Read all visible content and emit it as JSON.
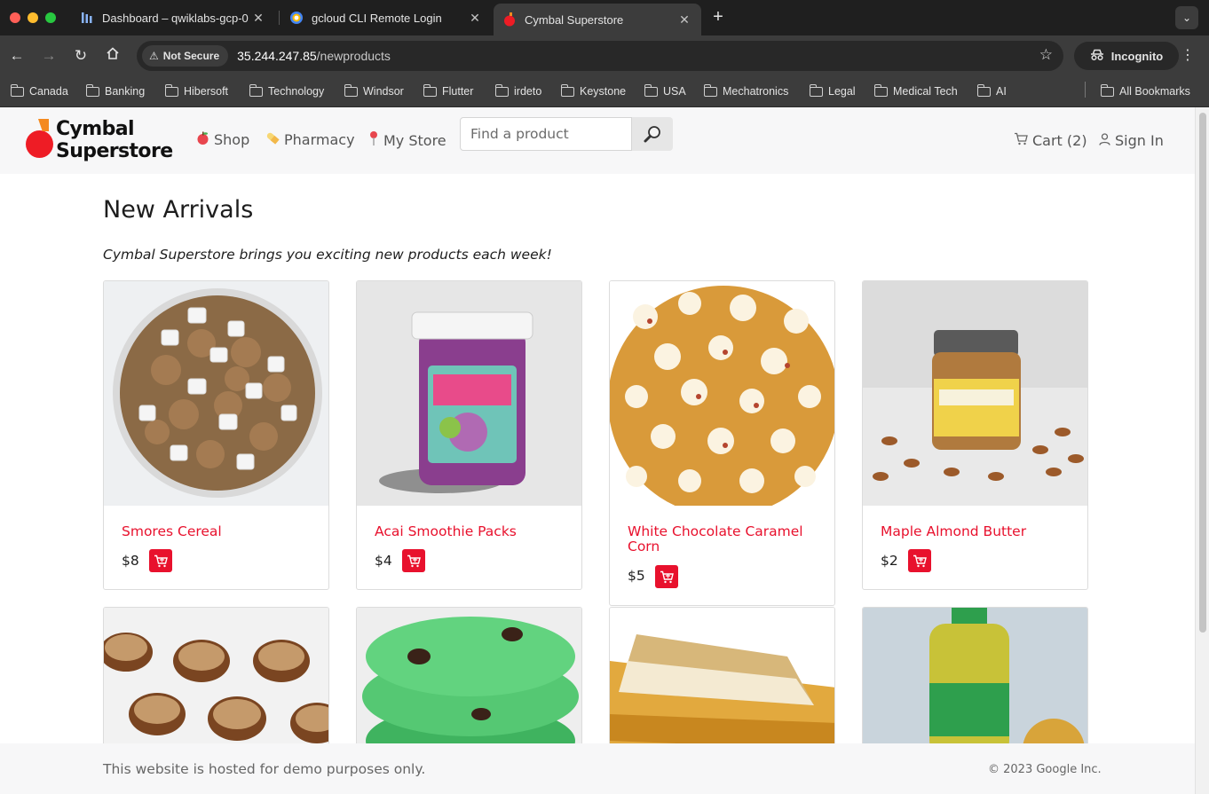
{
  "browser": {
    "tabs": [
      {
        "title": "Dashboard – qwiklabs-gcp-0",
        "active": false
      },
      {
        "title": "gcloud CLI Remote Login",
        "active": false
      },
      {
        "title": "Cymbal Superstore",
        "active": true
      }
    ],
    "security_chip": "Not Secure",
    "url_host": "35.244.247.85",
    "url_path": "/newproducts",
    "incognito_label": "Incognito",
    "bookmarks": [
      "Canada",
      "Banking",
      "Hibersoft",
      "Technology",
      "Windsor",
      "Flutter",
      "irdeto",
      "Keystone",
      "USA",
      "Mechatronics",
      "Legal",
      "Medical Tech",
      "AI"
    ],
    "all_bookmarks_label": "All Bookmarks"
  },
  "site": {
    "logo_line1": "Cymbal",
    "logo_line2": "Superstore",
    "nav": [
      {
        "label": "Shop",
        "icon": "apple-icon"
      },
      {
        "label": "Pharmacy",
        "icon": "pill-icon"
      },
      {
        "label": "My Store",
        "icon": "map-pin-icon"
      }
    ],
    "search_placeholder": "Find a product",
    "cart_label": "Cart (2)",
    "signin_label": "Sign In",
    "accent_color": "#e8112d"
  },
  "main": {
    "title": "New Arrivals",
    "tagline": "Cymbal Superstore brings you exciting new products each week!",
    "products": [
      {
        "name": "Smores Cereal",
        "price": "$8"
      },
      {
        "name": "Acai Smoothie Packs",
        "price": "$4"
      },
      {
        "name": "White Chocolate Caramel Corn",
        "price": "$5"
      },
      {
        "name": "Maple Almond Butter",
        "price": "$2"
      }
    ]
  },
  "footer": {
    "note": "This website is hosted for demo purposes only.",
    "copyright": "© 2023 Google Inc."
  }
}
